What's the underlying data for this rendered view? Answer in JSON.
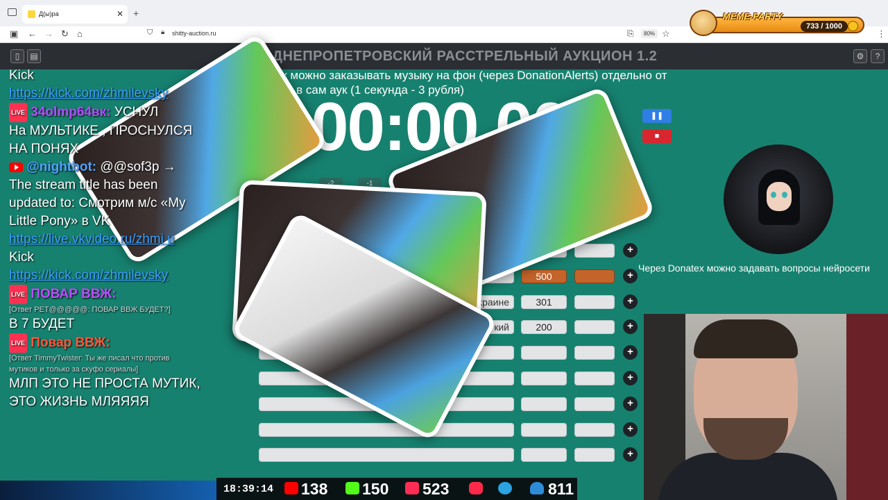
{
  "browser": {
    "tab_title": "Д(ы)ра",
    "url": "shitty-auction.ru",
    "zoom": "80%"
  },
  "meme_party": {
    "title": "MEME-PARTY",
    "count": "733 / 1000"
  },
  "auction": {
    "title": "ДНЕПРОПЕТРОВСКИЙ РАССТРЕЛЬНЫЙ АУКЦИОН 1.2",
    "notice": "На аук можно заказывать музыку на фон (через DonationAlerts) отдельно от заказов в сам аук (1 секунда - 3 рубля)",
    "timer": "00:00.000",
    "small_buttons": [
      "-2",
      "-1"
    ],
    "donatex_text": "Через Donatex можно задавать вопросы нейросети",
    "rows": [
      {
        "name": "",
        "value": "",
        "highlight": false
      },
      {
        "name": "",
        "value": "500",
        "highlight": true
      },
      {
        "name": "краине",
        "value": "301",
        "highlight": false
      },
      {
        "name": "кий",
        "value": "200",
        "highlight": false
      },
      {
        "name": "",
        "value": "",
        "highlight": false
      },
      {
        "name": "",
        "value": "",
        "highlight": false
      },
      {
        "name": "",
        "value": "",
        "highlight": false
      },
      {
        "name": "",
        "value": "",
        "highlight": false
      },
      {
        "name": "",
        "value": "",
        "highlight": false
      }
    ],
    "accent_color": "#17816f"
  },
  "chat": {
    "lines": {
      "l1": "Kick",
      "l2": "https://kick.com/zhmilevsky",
      "l3_user": "34olmp64вк:",
      "l3_msg": "УСНУЛ",
      "l4": "На МУЛЬТИКЕ , ПРОСНУЛСЯ",
      "l5": "НА ПОНЯХ",
      "l6_user": "@nightbot:",
      "l6_msg": "@@sof3p →",
      "l7": "The stream title has been",
      "l8": "updated to: Смотрим м/с «My",
      "l9": "Little Pony» в VK",
      "l10": "https://live.vkvideo.ru/zhmi и",
      "l11": "Kick",
      "l12": "https://kick.com/zhmilevsky",
      "l13_user": "ПОВАР ВВЖ:",
      "l14": "[Ответ PET@@@@@: ПОВАР ВВЖ БУДЕТ?]",
      "l15": "В 7 БУДЕТ",
      "l16_user": "Повар ВВЖ:",
      "l17": "[Ответ TimmyTwister: Ты же писал что против",
      "l18": "мутиков и только за скуфо сериалы]",
      "l19": "МЛП ЭТО НЕ ПРОСТА МУТИК,",
      "l20": "ЭТО ЖИЗНЬ МЛЯЯЯЯ"
    }
  },
  "stats": {
    "time": "18:39:14",
    "youtube": "138",
    "kick": "150",
    "vk_live": "523",
    "viewers": "811"
  }
}
